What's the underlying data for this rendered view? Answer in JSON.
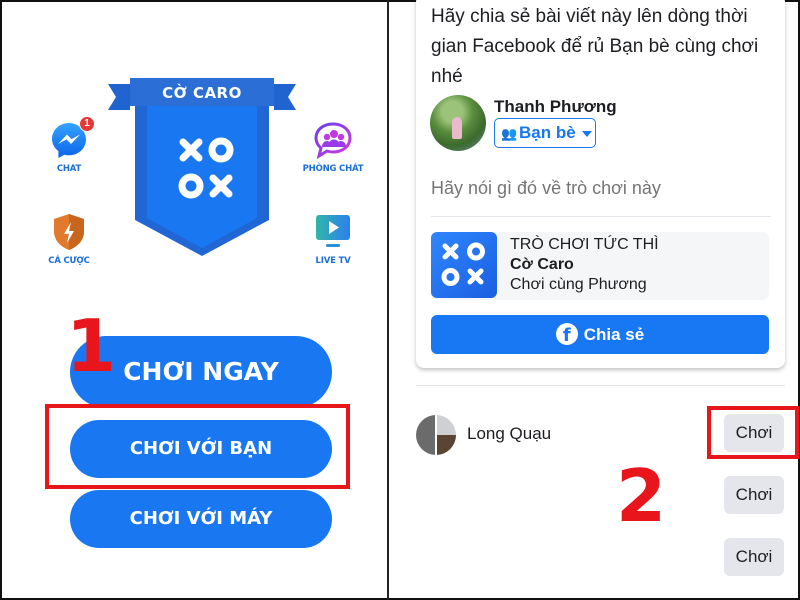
{
  "left_panel": {
    "badge_title": "CỜ CARO",
    "badge_glyphs": [
      "X",
      "O",
      "O",
      "X"
    ],
    "side_icons": [
      {
        "name": "chat",
        "label": "CHAT",
        "icon": "messenger-icon",
        "badge_count": "1"
      },
      {
        "name": "phong-chat",
        "label": "PHÒNG CHÁT",
        "icon": "group-chat-icon"
      },
      {
        "name": "ca-cuoc",
        "label": "CÁ CƯỢC",
        "icon": "shield-lightning-icon"
      },
      {
        "name": "live-tv",
        "label": "LIVE TV",
        "icon": "tv-play-icon"
      }
    ],
    "buttons": {
      "play_now": "CHƠI NGAY",
      "play_friend": "CHƠI VỚI BẠN",
      "play_machine": "CHƠI VỚI MÁY"
    },
    "step_label": "1"
  },
  "right_panel": {
    "share_message": "Hãy chia sẻ bài viết này lên dòng thời gian Facebook để rủ Bạn bè cùng chơi nhé",
    "user_name": "Thanh Phương",
    "audience": "Bạn bè",
    "comment_placeholder": "Hãy nói gì đó về trò chơi này",
    "game": {
      "category": "TRÒ CHƠI TỨC THÌ",
      "name": "Cờ Caro",
      "subtitle": "Chơi cùng Phương"
    },
    "share_button": "Chia sẻ",
    "friends": [
      {
        "name": "Long Quạu",
        "action": "Chơi"
      },
      {
        "name": "",
        "action": "Chơi"
      },
      {
        "name": "",
        "action": "Chơi"
      }
    ],
    "step_label": "2"
  },
  "colors": {
    "primary_blue": "#1a77f2",
    "facebook_blue": "#1877f2",
    "highlight_red": "#e6161a",
    "secondary_button_gray": "#e4e6eb"
  }
}
